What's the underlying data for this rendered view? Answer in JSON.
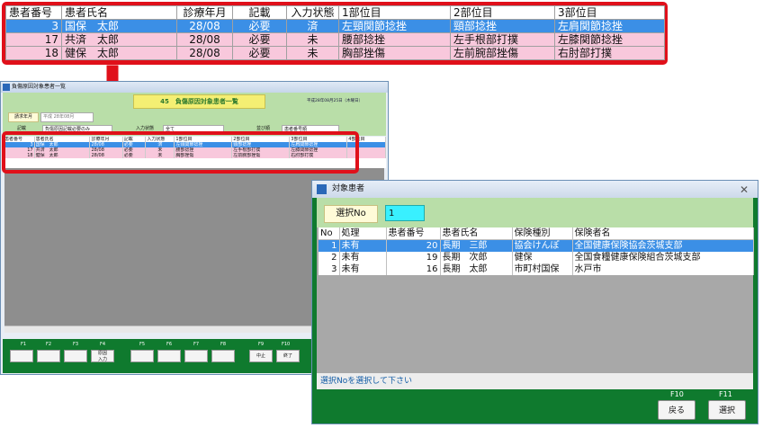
{
  "zoom": {
    "headers": [
      "患者番号",
      "患者氏名",
      "診療年月",
      "記載",
      "入力状態",
      "1部位目",
      "2部位目",
      "3部位目"
    ],
    "rows": [
      {
        "no": "3",
        "name": "国保　太郎",
        "ym": "28/08",
        "kisai": "必要",
        "state": "済",
        "p1": "左頸関節捻挫",
        "p2": "頸部捻挫",
        "p3": "左肩関節捻挫"
      },
      {
        "no": "17",
        "name": "共済　太郎",
        "ym": "28/08",
        "kisai": "必要",
        "state": "未",
        "p1": "腰部捻挫",
        "p2": "左手根部打撲",
        "p3": "左膝関節捻挫"
      },
      {
        "no": "18",
        "name": "健保　太郎",
        "ym": "28/08",
        "kisai": "必要",
        "state": "未",
        "p1": "胸部挫傷",
        "p2": "左前腕部挫傷",
        "p3": "右肘部打撲"
      }
    ]
  },
  "main": {
    "title": "負傷原因対象患者一覧",
    "banner": "45　負傷原因対象患者一覧",
    "date": "平成28年08月25日（木曜日）",
    "seikyu_label": "請求年月",
    "seikyu_value": "平成 28年08月",
    "filter1_label": "記載",
    "filter1_value": "負傷原因記載必要のみ",
    "filter2_label": "入力状態",
    "filter2_value": "全て",
    "filter3_label": "並び順",
    "filter3_value": "患者番号順",
    "mini_headers": [
      "患者番号",
      "患者氏名",
      "診療年月",
      "記載",
      "入力状態",
      "1部位目",
      "2部位目",
      "3部位目",
      "4部位目"
    ],
    "fkeys": [
      "F1",
      "F2",
      "F3",
      "F4",
      "F5",
      "F6",
      "F7",
      "F8",
      "F9",
      "F10"
    ],
    "fbuttons": {
      "f4": "原因\n入力",
      "f9": "中止",
      "f10": "終了"
    }
  },
  "dialog": {
    "title": "対象患者",
    "close": "✕",
    "select_label": "選択No",
    "select_value": "1",
    "headers": [
      "No",
      "処理",
      "患者番号",
      "患者氏名",
      "保険種別",
      "保険者名"
    ],
    "rows": [
      {
        "no": "1",
        "proc": "未有",
        "pid": "20",
        "name": "長期　三郎",
        "type": "協会けんぽ",
        "insurer": "全国健康保険協会茨城支部"
      },
      {
        "no": "2",
        "proc": "未有",
        "pid": "19",
        "name": "長期　次郎",
        "type": "健保",
        "insurer": "全国食糧健康保険組合茨城支部"
      },
      {
        "no": "3",
        "proc": "未有",
        "pid": "16",
        "name": "長期　太郎",
        "type": "市町村国保",
        "insurer": "水戸市"
      }
    ],
    "status": "選択Noを選択して下さい",
    "f10_label": "F10",
    "f11_label": "F11",
    "back_label": "戻る",
    "select_btn_label": "選択"
  },
  "colors": {
    "highlight": "#e0101a",
    "selected_row": "#3b8fe6",
    "pink_row": "#f8c8dc",
    "fkey_bar": "#0f7a2e"
  }
}
